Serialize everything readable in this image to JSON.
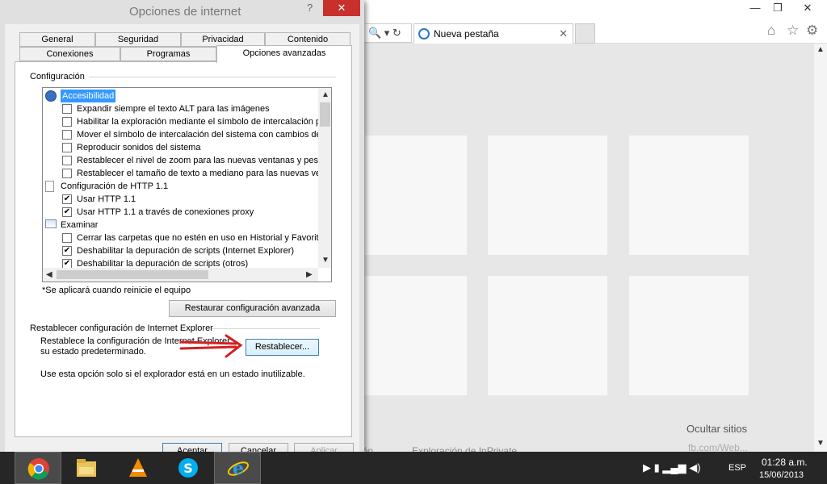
{
  "browser": {
    "tab_title": "Nueva pestaña",
    "tab_close": "✕",
    "address_tools": "🔍 ▾ ↻",
    "minimize": "—",
    "maximize": "❐",
    "close": "✕",
    "hide_sites": "Ocultar sitios",
    "footer_left": "ción",
    "footer_inprivate": "Exploración de InPrivate",
    "watermark": "fb.com/Web..."
  },
  "dialog": {
    "title": "Opciones de internet",
    "help": "?",
    "close": "✕",
    "tabs_row1": [
      "General",
      "Seguridad",
      "Privacidad",
      "Contenido"
    ],
    "tabs_row2": [
      "Conexiones",
      "Programas",
      "Opciones avanzadas"
    ],
    "settings_label": "Configuración",
    "settings": [
      {
        "type": "category",
        "icon": "accessibility-icon",
        "label": "Accesibilidad",
        "selected": true
      },
      {
        "type": "check",
        "checked": false,
        "label": "Expandir siempre el texto ALT para las imágenes"
      },
      {
        "type": "check",
        "checked": false,
        "label": "Habilitar la exploración mediante el símbolo de intercalación par"
      },
      {
        "type": "check",
        "checked": false,
        "label": "Mover el símbolo de intercalación del sistema con cambios de fo"
      },
      {
        "type": "check",
        "checked": false,
        "label": "Reproducir sonidos del sistema"
      },
      {
        "type": "check",
        "checked": false,
        "label": "Restablecer el nivel de zoom para las nuevas ventanas y pesta"
      },
      {
        "type": "check",
        "checked": false,
        "label": "Restablecer el tamaño de texto a mediano para las nuevas ver"
      },
      {
        "type": "category",
        "icon": "document-icon",
        "label": "Configuración de HTTP 1.1",
        "selected": false
      },
      {
        "type": "check",
        "checked": true,
        "label": "Usar HTTP 1.1"
      },
      {
        "type": "check",
        "checked": true,
        "label": "Usar HTTP 1.1 a través de conexiones proxy"
      },
      {
        "type": "category",
        "icon": "browse-icon",
        "label": "Examinar",
        "selected": false
      },
      {
        "type": "check",
        "checked": false,
        "label": "Cerrar las carpetas que no estén en uso en Historial y Favorito"
      },
      {
        "type": "check",
        "checked": true,
        "label": "Deshabilitar la depuración de scripts (Internet Explorer)"
      },
      {
        "type": "check",
        "checked": true,
        "label": "Deshabilitar la depuración de scripts (otros)"
      }
    ],
    "restart_note": "*Se aplicará cuando reinicie el equipo",
    "restore_advanced_button": "Restaurar configuración avanzada",
    "reset_group_label": "Restablecer configuración de Internet Explorer",
    "reset_desc_line1": "Restablece la configuración de Internet Explorer",
    "reset_desc_line2": "su estado predeterminado.",
    "reset_button": "Restablecer...",
    "reset_note": "Use esta opción solo si el explorador está en un estado inutilizable.",
    "ok_button": "Aceptar",
    "cancel_button": "Cancelar",
    "apply_button": "Aplicar"
  },
  "taskbar": {
    "items": [
      "chrome-icon",
      "file-explorer-icon",
      "vlc-icon",
      "skype-icon",
      "internet-explorer-icon"
    ],
    "tray_icons": "▶ ▮ ▂▄▆ ◀)",
    "language": "ESP",
    "time": "01:28 a.m.",
    "date": "15/06/2013"
  },
  "colors": {
    "selection": "#3399ff",
    "close_red": "#c7302b",
    "arrow_red": "#d42020"
  }
}
